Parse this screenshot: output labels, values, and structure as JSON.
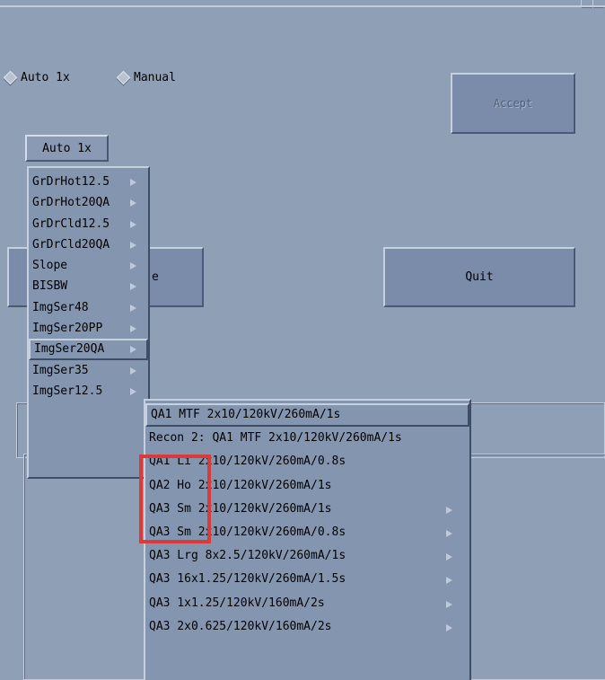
{
  "mode": {
    "options": [
      {
        "label": "Auto 1x"
      },
      {
        "label": "Manual"
      }
    ]
  },
  "buttons": {
    "accept": "Accept",
    "quit": "Quit",
    "hidden_fragment": "e"
  },
  "option_button": {
    "label": "Auto 1x"
  },
  "protocol_menu": {
    "items": [
      {
        "label": "GrDrHot12.5",
        "has_submenu": true
      },
      {
        "label": "GrDrHot20QA",
        "has_submenu": true
      },
      {
        "label": "GrDrCld12.5",
        "has_submenu": true
      },
      {
        "label": "GrDrCld20QA",
        "has_submenu": true
      },
      {
        "label": "Slope",
        "has_submenu": true
      },
      {
        "label": "BISBW",
        "has_submenu": true
      },
      {
        "label": "ImgSer48",
        "has_submenu": true
      },
      {
        "label": "ImgSer20PP",
        "has_submenu": true
      },
      {
        "label": "ImgSer20QA",
        "has_submenu": true,
        "selected": true
      },
      {
        "label": "ImgSer35",
        "has_submenu": true
      },
      {
        "label": "ImgSer12.5",
        "has_submenu": true
      }
    ]
  },
  "submenu": {
    "items": [
      {
        "label": "QA1 MTF 2x10/120kV/260mA/1s",
        "has_submenu": false,
        "selected": true
      },
      {
        "label": "Recon 2: QA1 MTF 2x10/120kV/260mA/1s",
        "has_submenu": false
      },
      {
        "label": "QA1 Li 2x10/120kV/260mA/0.8s",
        "has_submenu": false
      },
      {
        "label": "QA2 Ho 2x10/120kV/260mA/1s",
        "has_submenu": false
      },
      {
        "label": "QA3 Sm 2x10/120kV/260mA/1s",
        "has_submenu": true
      },
      {
        "label": "QA3 Sm 2x10/120kV/260mA/0.8s",
        "has_submenu": true
      },
      {
        "label": "QA3 Lrg 8x2.5/120kV/260mA/1s",
        "has_submenu": true
      },
      {
        "label": "QA3 16x1.25/120kV/260mA/1.5s",
        "has_submenu": true
      },
      {
        "label": "QA3 1x1.25/120kV/160mA/2s",
        "has_submenu": true
      },
      {
        "label": "QA3 2x0.625/120kV/160mA/2s",
        "has_submenu": true
      }
    ]
  },
  "colors": {
    "background": "#8f9fb6",
    "highlight": "#d93a3a"
  }
}
